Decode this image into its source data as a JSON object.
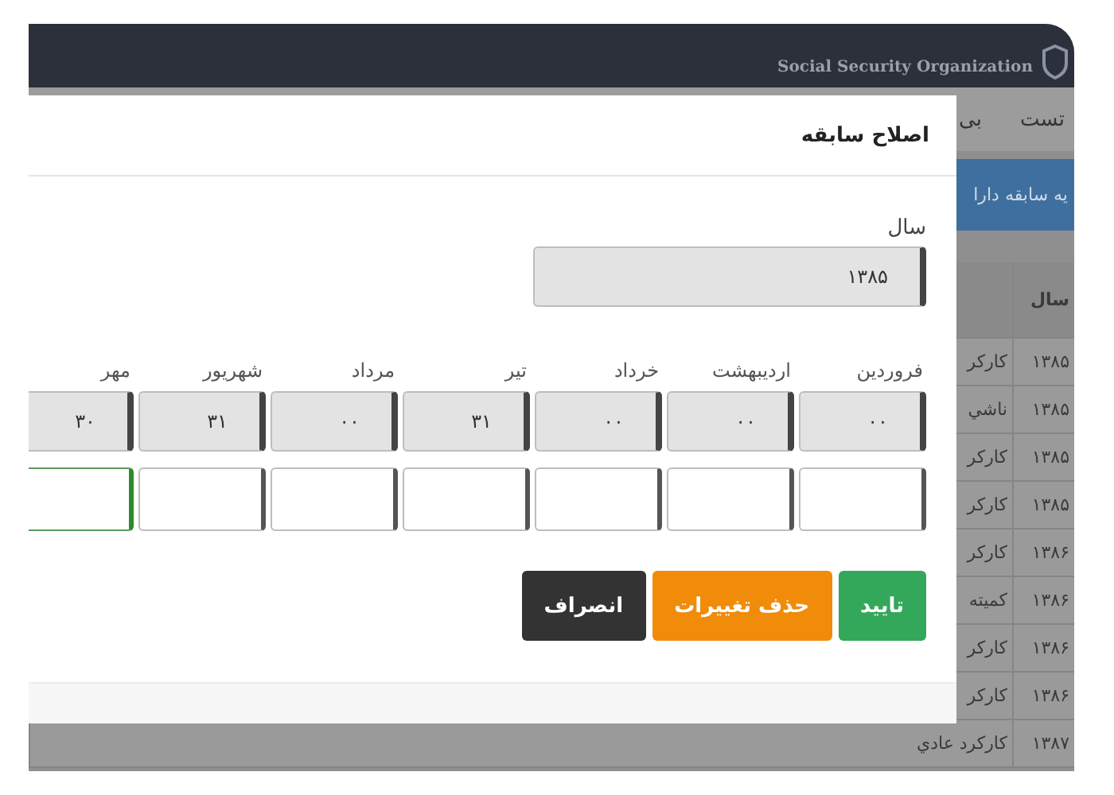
{
  "background": {
    "header_title": "Social Security Organization",
    "nav": [
      "تست",
      "بی"
    ],
    "banner": "یه سابقه دارا",
    "table": {
      "columns": [
        "سال"
      ],
      "rows": [
        {
          "year": "۱۳۸۵",
          "column_2": "کارکر"
        },
        {
          "year": "۱۳۸۵",
          "column_2": "ناشي"
        },
        {
          "year": "۱۳۸۵",
          "column_2": "کارکر"
        },
        {
          "year": "۱۳۸۵",
          "column_2": "کارکر"
        },
        {
          "year": "۱۳۸۶",
          "column_2": "کارکر"
        },
        {
          "year": "۱۳۸۶",
          "column_2": "کمیته"
        },
        {
          "year": "۱۳۸۶",
          "column_2": "کارکر"
        },
        {
          "year": "۱۳۸۶",
          "column_2": "کارکر"
        },
        {
          "year": "۱۳۸۷",
          "column_2": "کارکرد عادي"
        }
      ]
    }
  },
  "dialog": {
    "title": "اصلاح سابقه",
    "year_label": "سال",
    "year_value": "۱۳۸۵",
    "months": [
      {
        "label": "فروردین",
        "value": "۰۰",
        "focused": false
      },
      {
        "label": "اردیبهشت",
        "value": "۰۰",
        "focused": false
      },
      {
        "label": "خرداد",
        "value": "۰۰",
        "focused": false
      },
      {
        "label": "تیر",
        "value": "۳۱",
        "focused": false
      },
      {
        "label": "مرداد",
        "value": "۰۰",
        "focused": false
      },
      {
        "label": "شهریور",
        "value": "۳۱",
        "focused": false
      },
      {
        "label": "مهر",
        "value": "۳۰",
        "focused": true
      }
    ],
    "buttons": [
      {
        "label": "تایید",
        "kind": "confirm"
      },
      {
        "label": "حذف تغییرات",
        "kind": "reset"
      },
      {
        "label": "انصراف",
        "kind": "cancel"
      }
    ]
  }
}
